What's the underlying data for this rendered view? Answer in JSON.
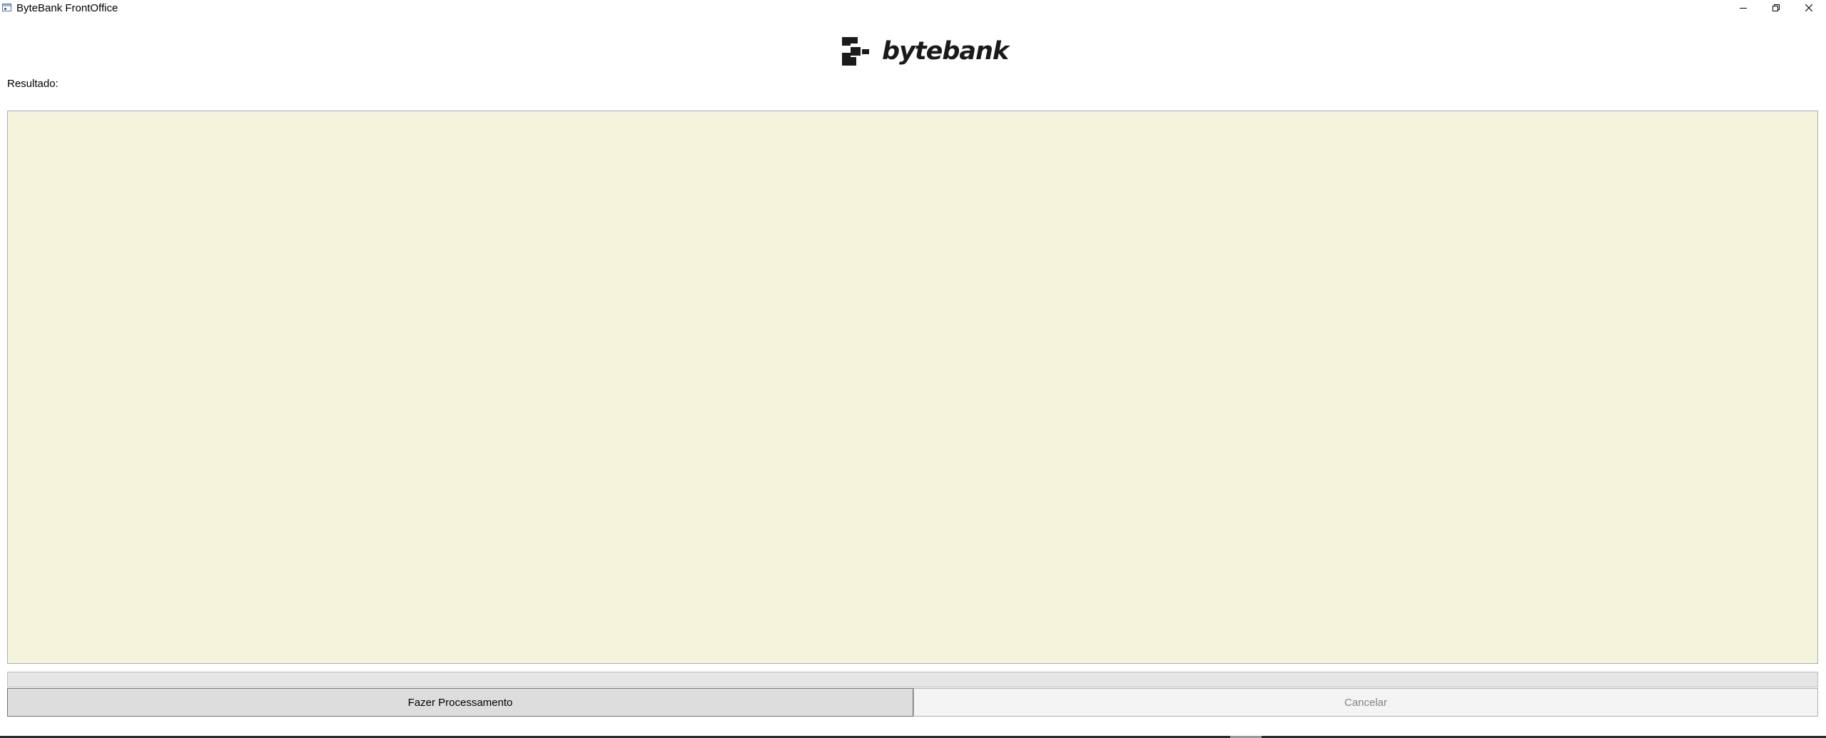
{
  "window": {
    "title": "ByteBank FrontOffice",
    "icon": "app-window-icon",
    "controls": {
      "minimize_icon": "minimize-icon",
      "restore_icon": "restore-icon",
      "close_icon": "close-icon"
    }
  },
  "logo": {
    "text": "bytebank",
    "mark_icon": "bytebank-logo-mark",
    "color": "#1a1a1a"
  },
  "result": {
    "label": "Resultado:",
    "value": "",
    "background_color": "#f4f4dc"
  },
  "progress": {
    "value": 0
  },
  "buttons": {
    "process_label": "Fazer Processamento",
    "cancel_label": "Cancelar",
    "cancel_enabled": false
  }
}
